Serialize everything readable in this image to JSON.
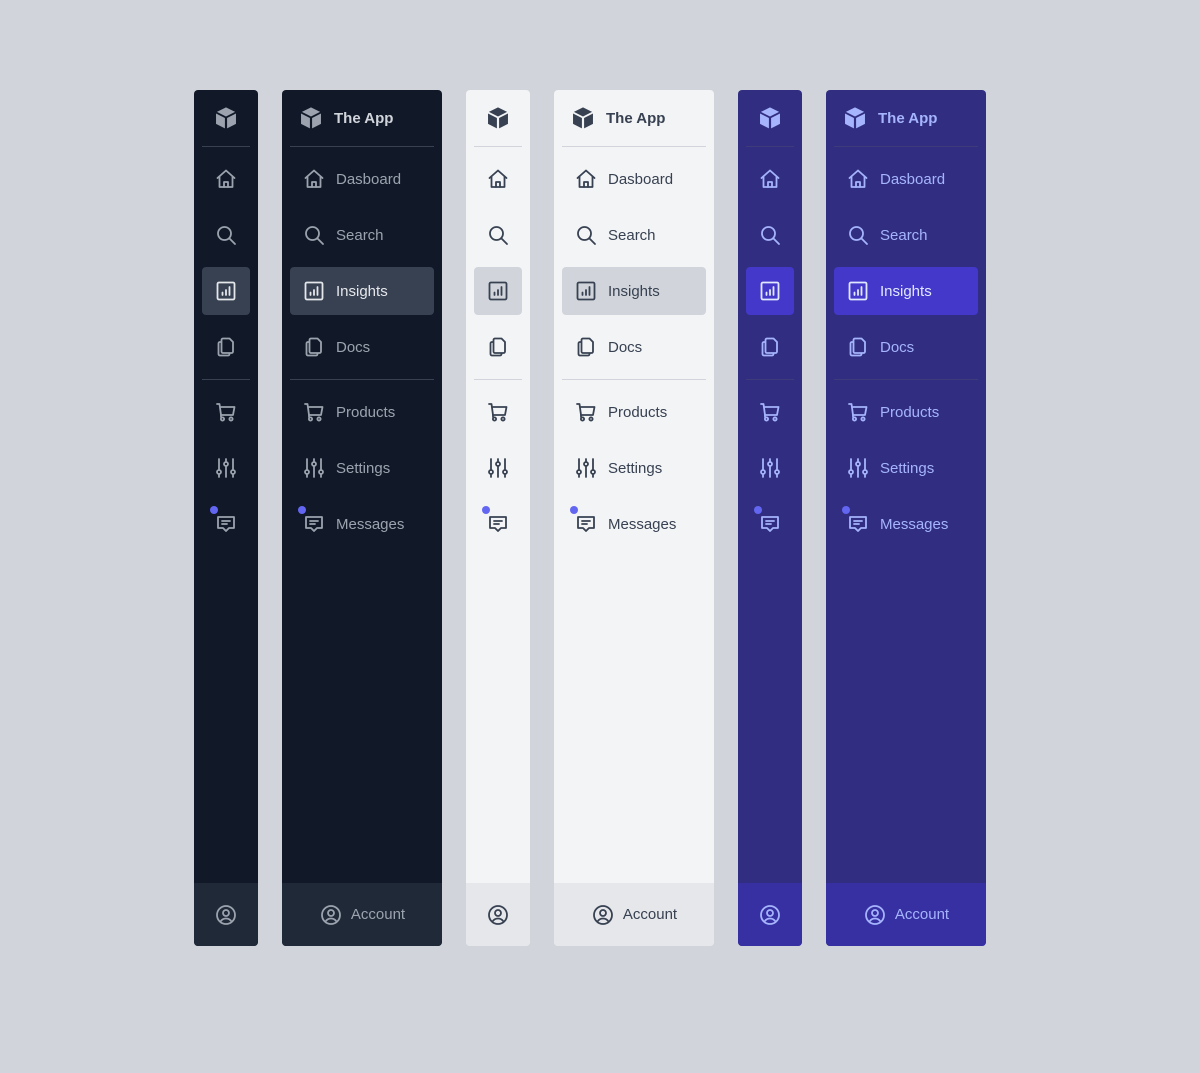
{
  "app": {
    "title": "The App",
    "logo_icon": "cube-icon"
  },
  "colors": {
    "dark": {
      "background": "#111827",
      "footer": "#1f2937",
      "active": "#374151",
      "text": "#9ca3af"
    },
    "light": {
      "background": "#f3f4f6",
      "footer": "#e5e7eb",
      "active": "#d1d5db",
      "text": "#374151"
    },
    "indigo": {
      "background": "#312e81",
      "footer": "#3730a3",
      "active": "#4338ca",
      "text": "#a5b4fc"
    },
    "notification_dot": "#6366f1"
  },
  "nav": {
    "primary": [
      {
        "label": "Dasboard",
        "icon": "home-icon"
      },
      {
        "label": "Search",
        "icon": "search-icon"
      },
      {
        "label": "Insights",
        "icon": "chart-icon",
        "active": true
      },
      {
        "label": "Docs",
        "icon": "docs-icon"
      }
    ],
    "secondary": [
      {
        "label": "Products",
        "icon": "cart-icon"
      },
      {
        "label": "Settings",
        "icon": "sliders-icon"
      },
      {
        "label": "Messages",
        "icon": "message-icon",
        "has_notification": true
      }
    ]
  },
  "footer": {
    "label": "Account",
    "icon": "user-circle-icon"
  },
  "variants": [
    {
      "theme": "dark",
      "layout": "collapsed"
    },
    {
      "theme": "dark",
      "layout": "expanded"
    },
    {
      "theme": "light",
      "layout": "collapsed"
    },
    {
      "theme": "light",
      "layout": "expanded"
    },
    {
      "theme": "indigo",
      "layout": "collapsed"
    },
    {
      "theme": "indigo",
      "layout": "expanded"
    }
  ]
}
